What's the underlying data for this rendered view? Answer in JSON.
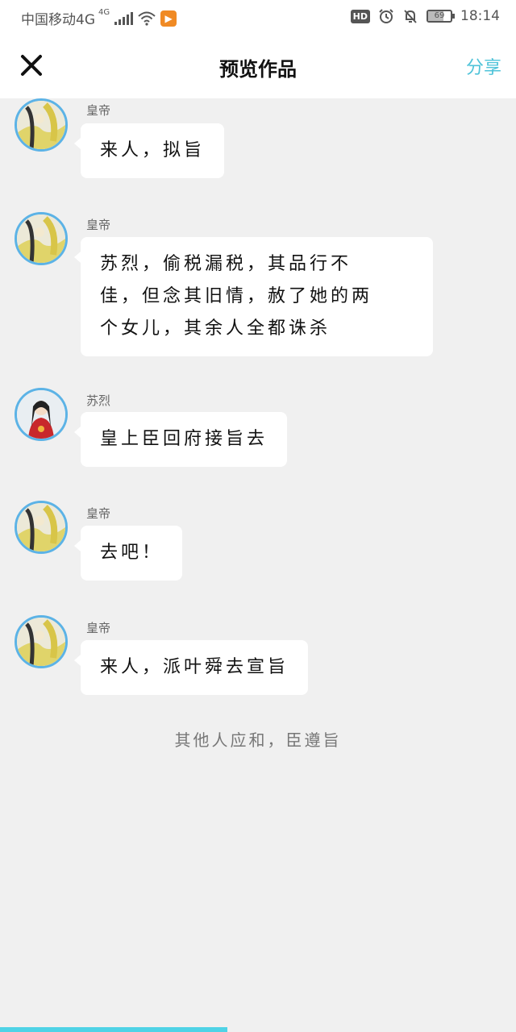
{
  "status_bar": {
    "carrier": "中国移动4G",
    "network_badge": "4G",
    "battery": "69",
    "battery_level": 0.69,
    "time": "18:14",
    "hd_label": "HD",
    "icons": [
      "signal-icon",
      "wifi-icon",
      "app-badge-icon",
      "hd-icon",
      "alarm-icon",
      "bell-muted-icon",
      "battery-icon"
    ]
  },
  "nav": {
    "title": "预览作品",
    "share_label": "分享",
    "close_icon": "close-icon"
  },
  "messages": [
    {
      "sender": "皇帝",
      "avatar": "emperor",
      "lines": [
        "来人，拟旨"
      ]
    },
    {
      "sender": "皇帝",
      "avatar": "emperor",
      "lines": [
        "苏烈，偷税漏税，其品行不",
        "佳，但念其旧情，赦了她的两",
        "个女儿，其余人全都诛杀"
      ]
    },
    {
      "sender": "苏烈",
      "avatar": "minister",
      "lines": [
        "皇上臣回府接旨去"
      ]
    },
    {
      "sender": "皇帝",
      "avatar": "emperor",
      "lines": [
        "去吧！"
      ]
    },
    {
      "sender": "皇帝",
      "avatar": "emperor",
      "lines": [
        "来人，派叶舜去宣旨"
      ]
    }
  ],
  "narration": "其他人应和，臣遵旨",
  "progress": 0.44,
  "colors": {
    "accent": "#4fc3d9",
    "avatar_border": "#5cb3e6",
    "background": "#f0f0f0",
    "progress": "#4fd3e6"
  }
}
